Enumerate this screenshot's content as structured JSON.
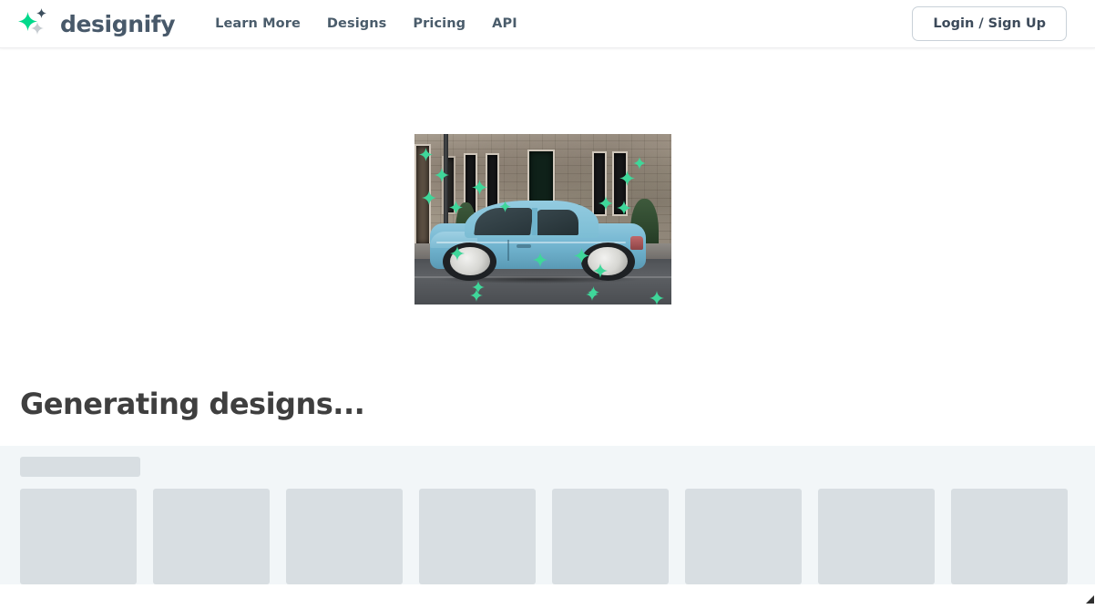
{
  "header": {
    "brand_name": "designify",
    "logo_icon": "sparkle-logo-icon",
    "nav": [
      {
        "label": "Learn More",
        "name": "nav-link-learn-more"
      },
      {
        "label": "Designs",
        "name": "nav-link-designs"
      },
      {
        "label": "Pricing",
        "name": "nav-link-pricing"
      },
      {
        "label": "API",
        "name": "nav-link-api"
      }
    ],
    "login_label": "Login / Sign Up"
  },
  "main": {
    "heading": "Generating designs...",
    "preview": {
      "alt": "Light blue Fiat 500 car parked in front of a stone building",
      "sparkle_icon": "sparkle-icon",
      "sparkle_color": "#3fd79a"
    },
    "skeleton": {
      "title_placeholder": "",
      "card_count": 8,
      "cards": [
        "",
        "",
        "",
        "",
        "",
        "",
        "",
        ""
      ]
    }
  },
  "colors": {
    "brand_green": "#00d98b",
    "brand_slate": "#48596a",
    "sparkle_green": "#3fd79a",
    "skeleton_bg": "#f2f6f8",
    "skeleton_block": "#d8dee2",
    "heading_text": "#3f3f3f",
    "page_bg": "#ffffff"
  }
}
